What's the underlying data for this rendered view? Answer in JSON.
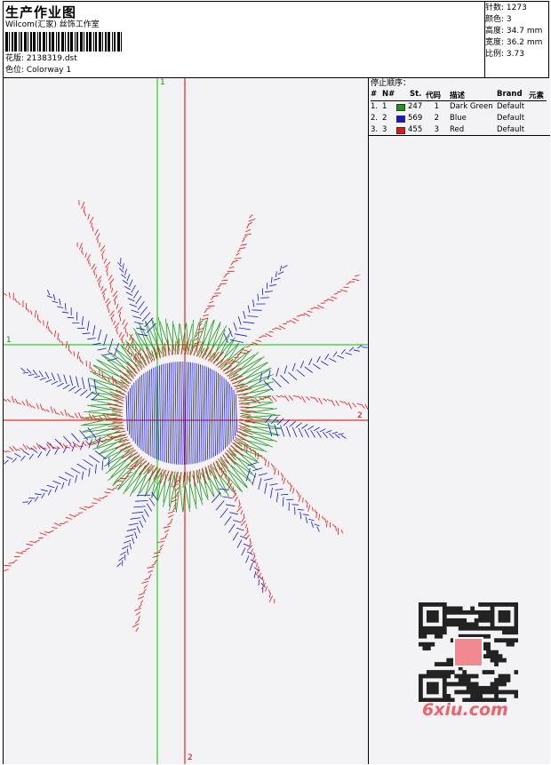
{
  "header": {
    "title": "生产作业图",
    "software": "Wilcom(汇家) 丝饰工作室",
    "design_label": "花版: 2138319.dst",
    "colorway_label": "色位: Colorway 1"
  },
  "stats": [
    {
      "label": "针数",
      "value": "1273"
    },
    {
      "label": "颜色",
      "value": "3"
    },
    {
      "label": "高度",
      "value": "34.7 mm"
    },
    {
      "label": "宽度",
      "value": "36.2 mm"
    },
    {
      "label": "比例",
      "value": "3.73"
    }
  ],
  "stop_panel": {
    "title": "停止顺序：",
    "headers": [
      "#",
      "N#",
      "St.",
      "代码",
      "描述",
      "Brand",
      "元素"
    ],
    "rows": [
      {
        "n": "1.",
        "nn": "1",
        "color": "#1a9a1a",
        "st": "247",
        "code": "1",
        "desc": "Dark Green",
        "brand": "Default"
      },
      {
        "n": "2.",
        "nn": "2",
        "color": "#1414e6",
        "st": "569",
        "code": "2",
        "desc": "Blue",
        "brand": "Default"
      },
      {
        "n": "3.",
        "nn": "3",
        "color": "#e61414",
        "st": "455",
        "code": "3",
        "desc": "Red",
        "brand": "Default"
      }
    ]
  },
  "guides": {
    "green_v": "1",
    "green_h": "1",
    "red_v": "2",
    "red_h": "2"
  },
  "watermark": {
    "text": "6xiu.com"
  }
}
